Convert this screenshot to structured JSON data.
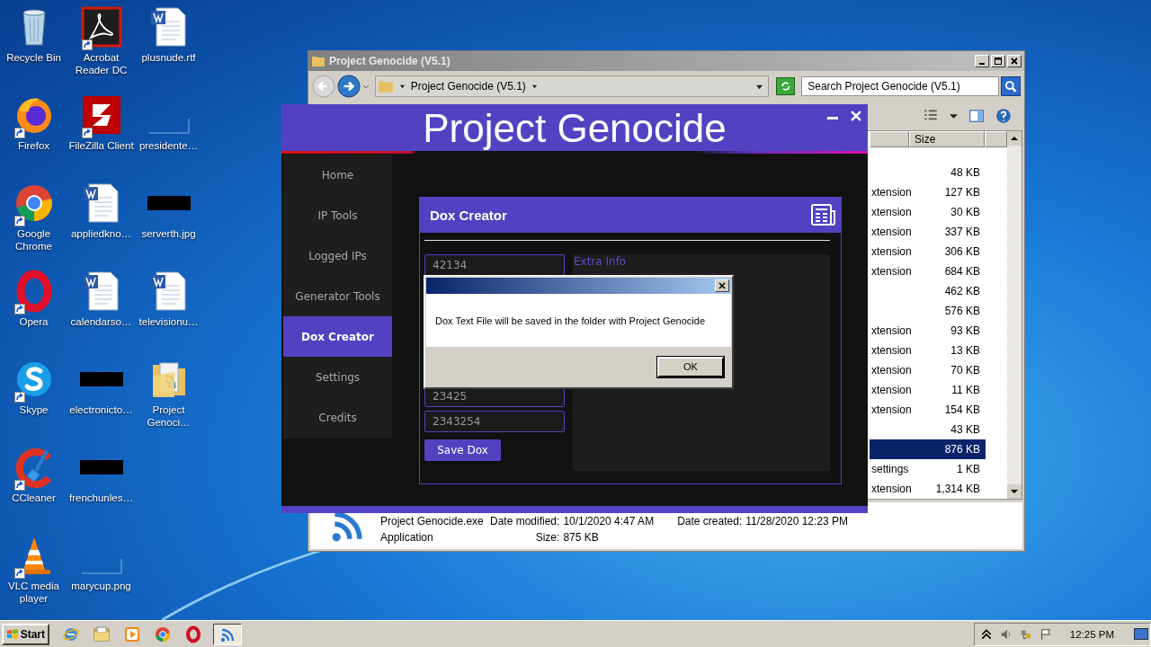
{
  "desktop": {
    "icons": [
      {
        "label": "Recycle Bin",
        "kind": "recycle",
        "shortcut": false
      },
      {
        "label": "Firefox",
        "kind": "firefox",
        "shortcut": true
      },
      {
        "label": "Google Chrome",
        "kind": "chrome",
        "shortcut": true
      },
      {
        "label": "Opera",
        "kind": "opera",
        "shortcut": true
      },
      {
        "label": "Skype",
        "kind": "skype",
        "shortcut": true
      },
      {
        "label": "CCleaner",
        "kind": "ccleaner",
        "shortcut": true
      },
      {
        "label": "VLC media player",
        "kind": "vlc",
        "shortcut": true
      },
      {
        "label": "Acrobat Reader DC",
        "kind": "pdf",
        "shortcut": true
      },
      {
        "label": "FileZilla Client",
        "kind": "filezilla",
        "shortcut": true
      },
      {
        "label": "appliedkno…",
        "kind": "word",
        "shortcut": false
      },
      {
        "label": "calendarso…",
        "kind": "word",
        "shortcut": false
      },
      {
        "label": "electronicto…",
        "kind": "thumb-dark",
        "shortcut": false
      },
      {
        "label": "frenchunles…",
        "kind": "thumb-dark",
        "shortcut": false
      },
      {
        "label": "marycup.png",
        "kind": "thumb-blank",
        "shortcut": false
      },
      {
        "label": "plusnude.rtf",
        "kind": "word",
        "shortcut": false
      },
      {
        "label": "presidente…",
        "kind": "thumb-blank",
        "shortcut": false
      },
      {
        "label": "serverth.jpg",
        "kind": "thumb-dark",
        "shortcut": false
      },
      {
        "label": "televisionu…",
        "kind": "word",
        "shortcut": false
      },
      {
        "label": "Project Genoci…",
        "kind": "folder",
        "shortcut": false
      }
    ]
  },
  "explorer": {
    "title": "Project Genocide (V5.1)",
    "address": "Project Genocide (V5.1)",
    "search": {
      "placeholder": "Search Project Genocide (V5.1)"
    },
    "columns": [
      "Size"
    ],
    "rows": [
      {
        "size": "48 KB",
        "selected": false
      },
      {
        "type": "xtension",
        "size": "127 KB",
        "selected": false
      },
      {
        "type": "xtension",
        "size": "30 KB",
        "selected": false
      },
      {
        "type": "xtension",
        "size": "337 KB",
        "selected": false
      },
      {
        "type": "xtension",
        "size": "306 KB",
        "selected": false
      },
      {
        "type": "xtension",
        "size": "684 KB",
        "selected": false
      },
      {
        "size": "462 KB",
        "selected": false
      },
      {
        "size": "576 KB",
        "selected": false
      },
      {
        "type": "xtension",
        "size": "93 KB",
        "selected": false
      },
      {
        "type": "xtension",
        "size": "13 KB",
        "selected": false
      },
      {
        "type": "xtension",
        "size": "70 KB",
        "selected": false
      },
      {
        "type": "xtension",
        "size": "11 KB",
        "selected": false
      },
      {
        "type": "xtension",
        "size": "154 KB",
        "selected": false
      },
      {
        "size": "43 KB",
        "selected": false
      },
      {
        "size": "876 KB",
        "selected": true
      },
      {
        "type": "settings",
        "size": "1 KB",
        "selected": false
      },
      {
        "type": "xtension",
        "size": "1,314 KB",
        "selected": false
      }
    ],
    "details": {
      "name": "Project Genocide.exe",
      "type": "Application",
      "fields": [
        {
          "label": "Date modified:",
          "value": "10/1/2020 4:47 AM"
        },
        {
          "label": "Date created:",
          "value": "11/28/2020 12:23 PM"
        },
        {
          "label": "Size:",
          "value": "875 KB"
        }
      ]
    }
  },
  "app": {
    "title": "Project Genocide",
    "nav": [
      {
        "label": "Home",
        "selected": false
      },
      {
        "label": "IP Tools",
        "selected": false
      },
      {
        "label": "Logged IPs",
        "selected": false
      },
      {
        "label": "Generator Tools",
        "selected": false
      },
      {
        "label": "Dox Creator",
        "selected": true
      },
      {
        "label": "Settings",
        "selected": false
      },
      {
        "label": "Credits",
        "selected": false
      }
    ],
    "panel": {
      "title": "Dox Creator",
      "fields": [
        "42134",
        "23425",
        "2343254"
      ],
      "extra_info": {
        "placeholder": "Extra Info"
      },
      "save_button": "Save Dox"
    }
  },
  "dialog": {
    "message": "Dox Text File will be saved in the folder with Project Genocide",
    "button": "OK"
  },
  "taskbar": {
    "start": "Start",
    "tasks": [
      {
        "kind": "ie",
        "selected": false
      },
      {
        "kind": "explorer",
        "selected": false
      },
      {
        "kind": "media",
        "selected": false
      },
      {
        "kind": "chrome",
        "selected": false
      },
      {
        "kind": "opera",
        "selected": false
      },
      {
        "kind": "app",
        "selected": true
      }
    ],
    "clock": "12:25 PM"
  }
}
